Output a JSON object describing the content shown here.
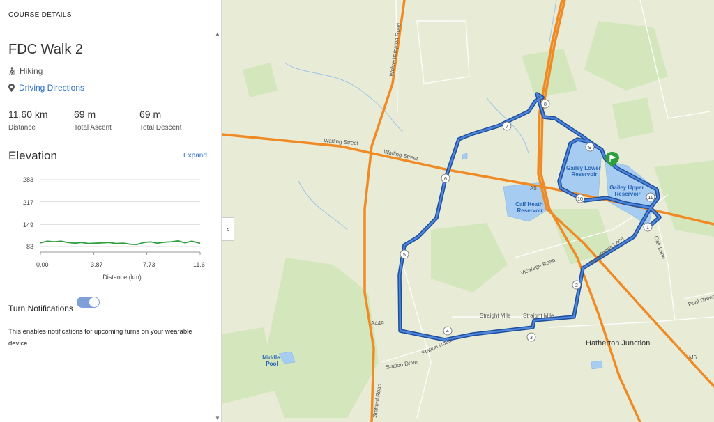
{
  "panel": {
    "section_title": "COURSE DETAILS",
    "course_name": "FDC Walk 2",
    "activity": "Hiking",
    "directions_link": "Driving Directions",
    "stats": [
      {
        "value": "11.60 km",
        "label": "Distance"
      },
      {
        "value": "69 m",
        "label": "Total Ascent"
      },
      {
        "value": "69 m",
        "label": "Total Descent"
      }
    ],
    "elevation": {
      "title": "Elevation",
      "expand": "Expand",
      "xlabel": "Distance (km)",
      "yticks": [
        "283",
        "217",
        "149",
        "83"
      ],
      "xticks": [
        "0.00",
        "3.87",
        "7.73",
        "11.6"
      ]
    },
    "notifications": {
      "label": "Turn Notifications",
      "enabled": true,
      "description": "This enables notifications for upcoming turns on your wearable device."
    }
  },
  "chart_data": {
    "type": "area",
    "xlabel": "Distance (km)",
    "ylabel": "",
    "xlim": [
      0,
      11.6
    ],
    "ylim": [
      83,
      283
    ],
    "yticks": [
      83,
      149,
      217,
      283
    ],
    "xticks": [
      0.0,
      3.87,
      7.73,
      11.6
    ],
    "series": [
      {
        "x": [
          0,
          0.5,
          1.0,
          1.5,
          2.0,
          2.5,
          3.0,
          3.5,
          4.0,
          4.5,
          5.0,
          5.5,
          6.0,
          6.5,
          7.0,
          7.5,
          8.0,
          8.5,
          9.0,
          9.5,
          10.0,
          10.5,
          11.0,
          11.6
        ],
        "y": [
          94,
          99,
          97,
          99,
          95,
          93,
          95,
          92,
          93,
          94,
          95,
          92,
          93,
          90,
          89,
          95,
          97,
          93,
          96,
          97,
          100,
          94,
          99,
          93
        ]
      }
    ],
    "line_color": "#2e9e3e",
    "grid": true
  },
  "map": {
    "road_labels": [
      "Wolverhampton Road",
      "Watling Street",
      "Watling Street",
      "A5",
      "A449",
      "Vicarage Road",
      "Straight Mile",
      "Straight Mile",
      "Station Road",
      "Station Drive",
      "Stafford Road",
      "Woodlands Lane",
      "Oak Lane",
      "Pool Green",
      "M6"
    ],
    "water_labels": [
      "Gailey Lower Reservoir",
      "Gailey Upper Reservoir",
      "Calf Heath Reservoir",
      "Middle Pool"
    ],
    "place_labels": [
      "Hatherton Junction"
    ],
    "waypoints": [
      "1",
      "2",
      "3",
      "4",
      "5",
      "6",
      "7",
      "8",
      "9",
      "10",
      "11"
    ],
    "route_color": "#2f66c2",
    "motorway_color": "#f08a24",
    "start_marker_color": "#2e9e3e"
  }
}
